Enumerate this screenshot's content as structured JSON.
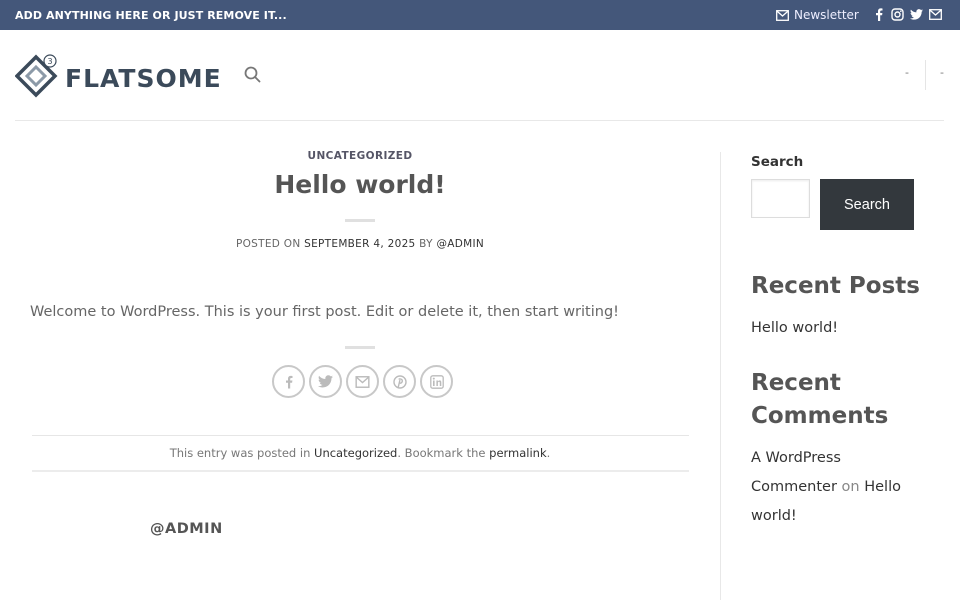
{
  "topbar": {
    "message": "ADD ANYTHING HERE OR JUST REMOVE IT...",
    "newsletter": "Newsletter",
    "social_icons": [
      "facebook-icon",
      "instagram-icon",
      "twitter-icon",
      "email-icon"
    ],
    "bg_color": "#44577a"
  },
  "header": {
    "logo_text": "FLATSOME",
    "logo_badge": "3",
    "nav_right_1": "-",
    "nav_right_2": "-"
  },
  "post": {
    "category": "UNCATEGORIZED",
    "title": "Hello world!",
    "posted_on_label": "POSTED ON",
    "date": "SEPTEMBER 4, 2025",
    "by_label": "BY",
    "author": "@ADMIN",
    "body": "Welcome to WordPress. This is your first post. Edit or delete it, then start writing!",
    "share_icons": [
      "facebook-icon",
      "twitter-icon",
      "email-icon",
      "pinterest-icon",
      "linkedin-icon"
    ],
    "footer_prefix": "This entry was posted in",
    "footer_category": "Uncategorized",
    "footer_middle": ". Bookmark the",
    "footer_permalink": "permalink",
    "footer_suffix": ".",
    "author_box_name": "@ADMIN"
  },
  "sidebar": {
    "search_label": "Search",
    "search_button": "Search",
    "recent_posts_title": "Recent Posts",
    "recent_posts": [
      "Hello world!"
    ],
    "recent_comments_title": "Recent Comments",
    "comment_author": "A WordPress Commenter",
    "comment_on": "on",
    "comment_post": "Hello world!",
    "button_color": "#33383d"
  }
}
